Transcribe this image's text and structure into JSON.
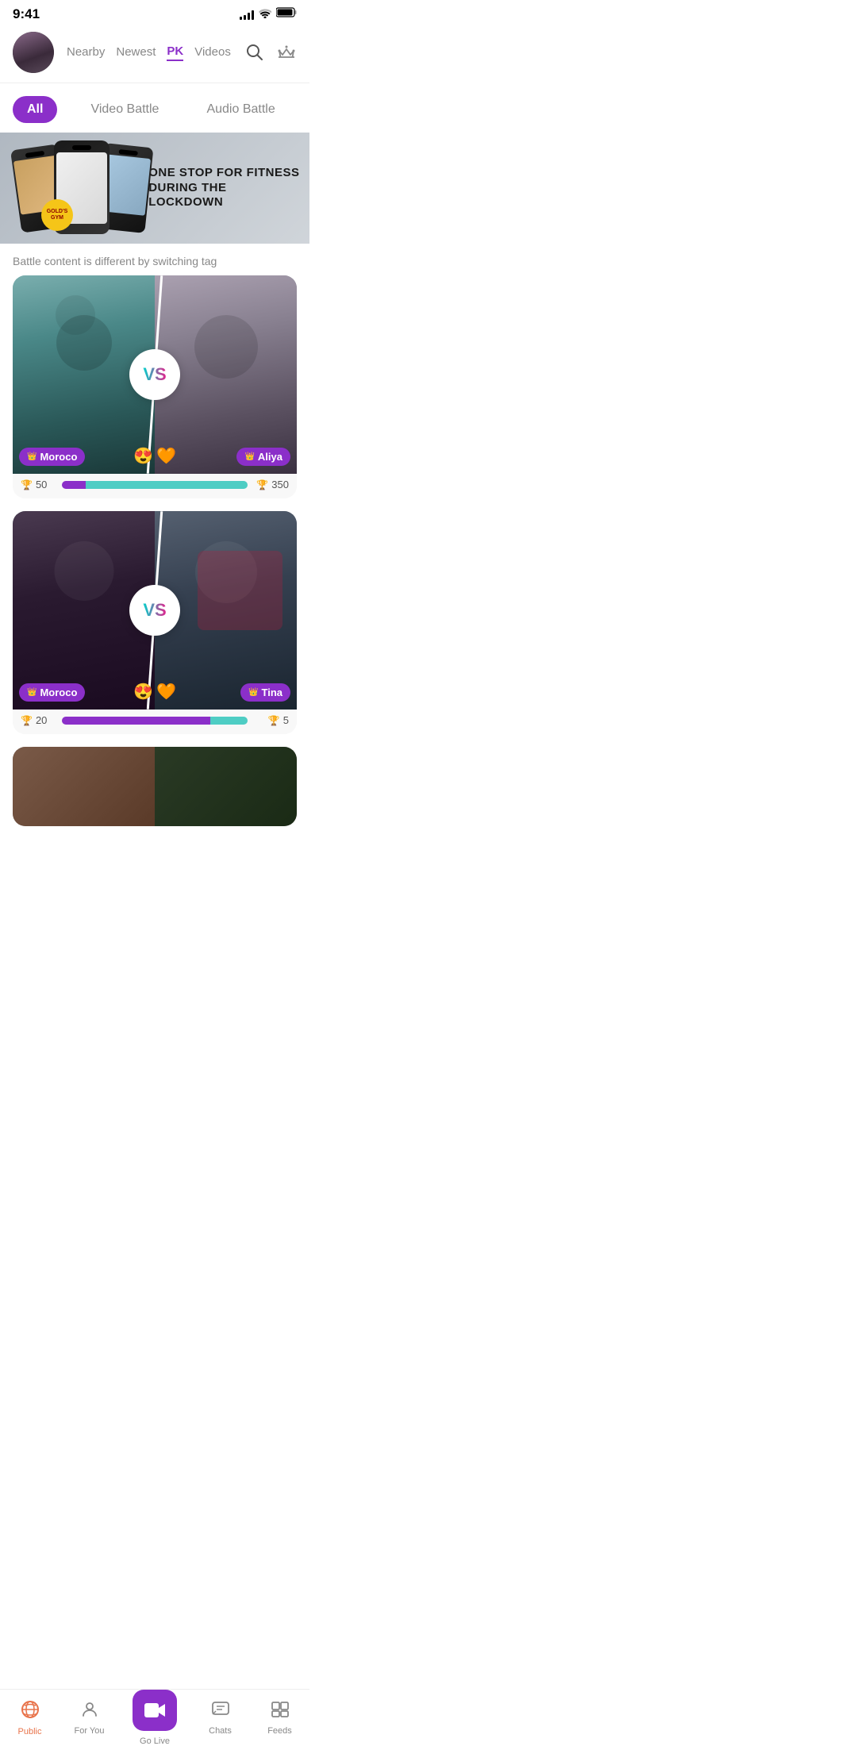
{
  "statusBar": {
    "time": "9:41",
    "signal": "full",
    "wifi": true,
    "battery": "full"
  },
  "header": {
    "tabs": [
      {
        "id": "nearby",
        "label": "Nearby"
      },
      {
        "id": "newest",
        "label": "Newest"
      },
      {
        "id": "pk",
        "label": "PK"
      },
      {
        "id": "videos",
        "label": "Videos"
      }
    ],
    "activeTab": "pk"
  },
  "filters": {
    "options": [
      {
        "id": "all",
        "label": "All"
      },
      {
        "id": "video-battle",
        "label": "Video Battle"
      },
      {
        "id": "audio-battle",
        "label": "Audio Battle"
      }
    ],
    "active": "all"
  },
  "banner": {
    "text1": "ONE STOP FOR FITNESS",
    "text2": "DURING THE LOCKDOWN",
    "brand": "GOLD'S"
  },
  "hint": {
    "text": "Battle content is different by switching tag"
  },
  "battles": [
    {
      "id": "battle-1",
      "left": {
        "name": "Moroco",
        "score": 50,
        "emoji": "😍"
      },
      "right": {
        "name": "Aliya",
        "score": 350,
        "emoji": "🧡"
      },
      "leftPercent": 13,
      "rightPercent": 87
    },
    {
      "id": "battle-2",
      "left": {
        "name": "Moroco",
        "score": 20,
        "emoji": "😍"
      },
      "right": {
        "name": "Tina",
        "score": 5,
        "emoji": "🧡"
      },
      "leftPercent": 80,
      "rightPercent": 20
    }
  ],
  "bottomNav": {
    "items": [
      {
        "id": "public",
        "label": "Public",
        "icon": "📡",
        "active": true
      },
      {
        "id": "for-you",
        "label": "For You",
        "icon": "👤",
        "active": false
      },
      {
        "id": "go-live",
        "label": "Go Live",
        "icon": "🎥",
        "active": false,
        "isCenter": true
      },
      {
        "id": "chats",
        "label": "Chats",
        "icon": "💬",
        "active": false
      },
      {
        "id": "feeds",
        "label": "Feeds",
        "icon": "☰",
        "active": false
      }
    ]
  }
}
